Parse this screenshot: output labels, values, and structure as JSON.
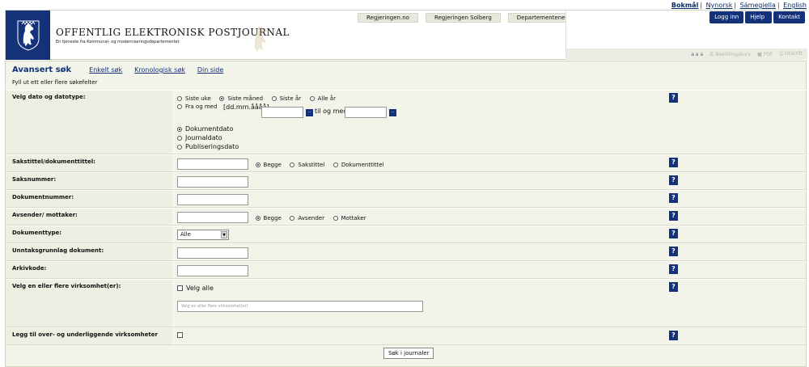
{
  "languages": [
    "Bokmål",
    "Nynorsk",
    "Sámegiella",
    "English"
  ],
  "header": {
    "title": "OFFENTLIG ELEKTRONISK POSTJOURNAL",
    "subtitle": "En tjeneste fra Kommunal- og moderniseringsdepartementet",
    "top_links": [
      "Regjeringen.no",
      "Regjeringen Solberg",
      "Departementene"
    ],
    "buttons": [
      "Logg inn",
      "Hjelp",
      "Kontakt"
    ],
    "text_size": "a a a",
    "tools": [
      "Bestillingskurv",
      "PDF",
      "Utskrift"
    ]
  },
  "tabs": {
    "current": "Avansert søk",
    "links": [
      "Enkelt søk",
      "Kronologisk søk",
      "Din side"
    ]
  },
  "hint": "Fyll ut ett eller flere søkefelter",
  "form": {
    "date": {
      "label": "Velg dato og datotype:",
      "periods": [
        "Siste uke",
        "Siste måned",
        "Siste år",
        "Alle år"
      ],
      "selected_period": "Siste måned",
      "from_label": "Fra og med",
      "format_hint": "[dd.mm.åååå]",
      "to_label": "til og med",
      "date_types": [
        "Dokumentdato",
        "Journaldato",
        "Publiseringsdato"
      ],
      "selected_date_type": "Dokumentdato"
    },
    "title": {
      "label": "Sakstittel/dokumenttittel:",
      "options": [
        "Begge",
        "Sakstittel",
        "Dokumenttittel"
      ],
      "selected": "Begge"
    },
    "case_number": {
      "label": "Saksnummer:"
    },
    "document_number": {
      "label": "Dokumentnummer:"
    },
    "sender": {
      "label": "Avsender/ mottaker:",
      "options": [
        "Begge",
        "Avsender",
        "Mottaker"
      ],
      "selected": "Begge"
    },
    "document_type": {
      "label": "Dokumenttype:",
      "value": "Alle"
    },
    "exemption": {
      "label": "Unntaksgrunnlag dokument:"
    },
    "archive_code": {
      "label": "Arkivkode:"
    },
    "agencies": {
      "label": "Velg en eller flere virksomhet(er):",
      "select_all": "Velg alle",
      "placeholder": "Velg en eller flere virksomhet(er)"
    },
    "sub_agencies": {
      "label": "Legg til over- og underliggende virksomheter"
    },
    "help_label": "?",
    "submit": "Søk i journaler"
  }
}
